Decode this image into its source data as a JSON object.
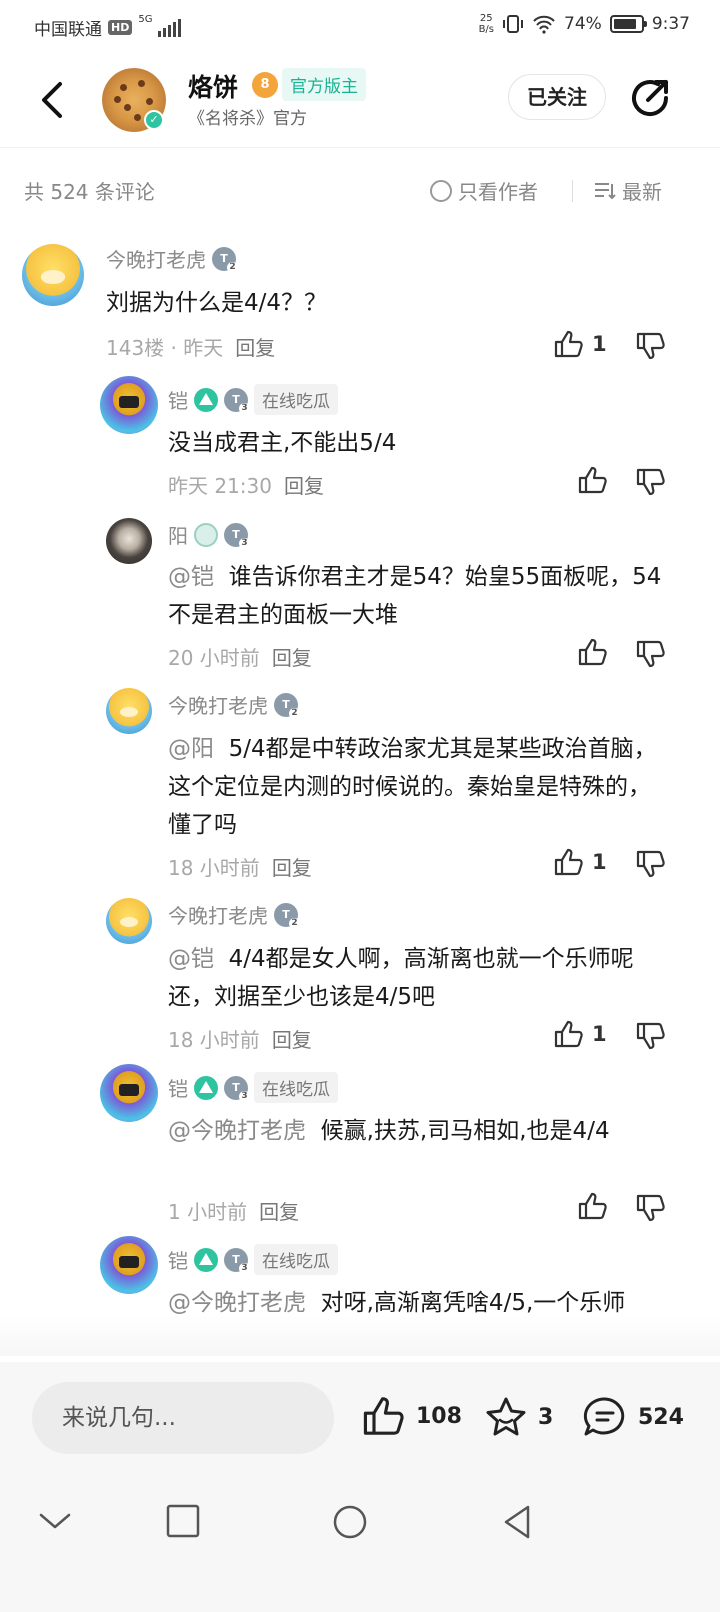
{
  "status": {
    "carrier": "中国联通",
    "hd": "HD",
    "network": "5G",
    "speed_top": "25",
    "speed_bottom": "B/s",
    "battery": "74%",
    "time": "9:37"
  },
  "header": {
    "forum_name": "烙饼",
    "level": "8",
    "mod_tag": "官方版主",
    "subtitle": "《名将杀》官方",
    "follow_label": "已关注"
  },
  "filter": {
    "total": "共 524 条评论",
    "only_author": "只看作者",
    "sort": "最新"
  },
  "comments": [
    {
      "user": "今晚打老虎",
      "level": "2",
      "text": "刘据为什么是4/4？？",
      "floor": "143楼 · 昨天",
      "reply": "回复",
      "likes": "1"
    },
    {
      "user": "铠",
      "level": "3",
      "tag": "在线吃瓜",
      "text": "没当成君主,不能出5/4",
      "time": "昨天 21:30",
      "reply": "回复",
      "likes": ""
    },
    {
      "user": "阳",
      "level": "3",
      "mention": "@铠",
      "text": "谁告诉你君主才是54？始皇55面板呢，54不是君主的面板一大堆",
      "time": "20 小时前",
      "reply": "回复",
      "likes": ""
    },
    {
      "user": "今晚打老虎",
      "level": "2",
      "mention": "@阳",
      "text": "5/4都是中转政治家尤其是某些政治首脑，这个定位是内测的时候说的。秦始皇是特殊的，懂了吗",
      "time": "18 小时前",
      "reply": "回复",
      "likes": "1"
    },
    {
      "user": "今晚打老虎",
      "level": "2",
      "mention": "@铠",
      "text": "4/4都是女人啊，高渐离也就一个乐师呢还，刘据至少也该是4/5吧",
      "time": "18 小时前",
      "reply": "回复",
      "likes": "1"
    },
    {
      "user": "铠",
      "level": "3",
      "tag": "在线吃瓜",
      "mention": "@今晚打老虎",
      "text": "候赢,扶苏,司马相如,也是4/4",
      "time": "1 小时前",
      "reply": "回复",
      "likes": ""
    },
    {
      "user": "铠",
      "level": "3",
      "tag": "在线吃瓜",
      "mention": "@今晚打老虎",
      "text": "对呀,高渐离凭啥4/5,一个乐师"
    }
  ],
  "bottom": {
    "input_placeholder": "来说几句...",
    "likes": "108",
    "favorites": "3",
    "comments": "524"
  },
  "icons": [
    "back-icon",
    "share-icon",
    "thumb-up-icon",
    "thumb-down-icon",
    "star-icon",
    "comment-icon",
    "nav-back-icon",
    "nav-home-icon",
    "nav-recents-icon",
    "nav-collapse-icon"
  ]
}
